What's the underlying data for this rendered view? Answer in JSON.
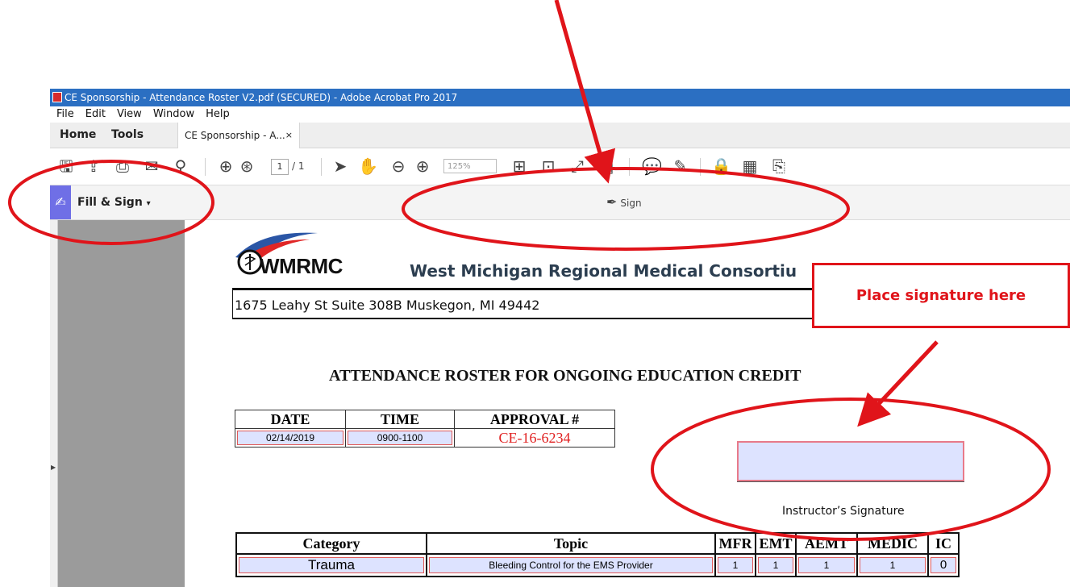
{
  "window": {
    "title": "CE Sponsorship - Attendance Roster V2.pdf (SECURED) - Adobe Acrobat Pro 2017"
  },
  "menu": [
    "File",
    "Edit",
    "View",
    "Window",
    "Help"
  ],
  "tabs": {
    "home": "Home",
    "tools": "Tools",
    "document": "CE Sponsorship - A...",
    "close": "×"
  },
  "toolbar": {
    "page_current": "1",
    "page_total": "/ 1",
    "zoom": "125%",
    "icons": [
      "save-icon",
      "cloud-upload-icon",
      "print-icon",
      "email-icon",
      "search-icon",
      "page-up-icon",
      "page-down-icon",
      "select-arrow-icon",
      "hand-icon",
      "zoom-out-icon",
      "zoom-in-icon",
      "fit-page-icon",
      "scroll-mode-icon",
      "full-screen-icon",
      "read-mode-icon",
      "comment-icon",
      "highlight-icon",
      "protect-icon",
      "fill-form-icon",
      "export-icon"
    ]
  },
  "fill_sign": {
    "label": "Fill & Sign",
    "caret": "▾",
    "sign_label": "Sign"
  },
  "document": {
    "logo_text": "WMRMC",
    "org_name": "West Michigan Regional Medical Consortiu",
    "address": "1675 Leahy St Suite 308B  Muskegon, MI 49442",
    "roster_title": "ATTENDANCE ROSTER FOR ONGOING EDUCATION CREDIT",
    "info_headers": [
      "DATE",
      "TIME",
      "APPROVAL #"
    ],
    "info_values": {
      "date": "02/14/2019",
      "time": "0900-1100",
      "approval": "CE-16-6234"
    },
    "signature_label": "Instructor’s Signature",
    "category_headers": [
      "Category",
      "Topic",
      "MFR",
      "EMT",
      "AEMT",
      "MEDIC",
      "IC"
    ],
    "category_values": {
      "category": "Trauma",
      "topic": "Bleeding Control for the EMS Provider",
      "mfr": "1",
      "emt": "1",
      "aemt": "1",
      "medic": "1",
      "ic": "0"
    }
  },
  "annotation": {
    "callout": "Place signature here",
    "color": "#e0141a"
  }
}
